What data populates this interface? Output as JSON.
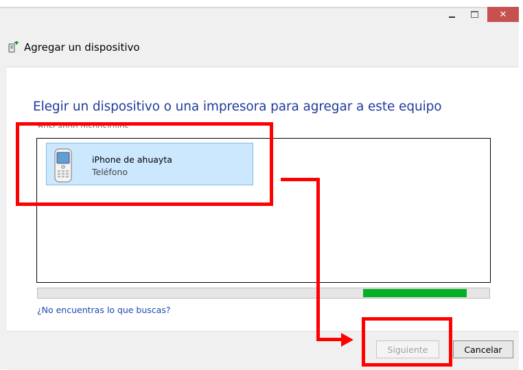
{
  "window": {
    "title": "Agregar un dispositivo",
    "minimize_symbol": "–",
    "maximize_symbol": "□",
    "close_symbol": "✕"
  },
  "main": {
    "heading": "Elegir un dispositivo o una impresora para agregar a este equipo",
    "status_text": "Buscando dispositivos",
    "devices": [
      {
        "name": "iPhone de ahuayta",
        "type": "Teléfono",
        "icon": "phone-icon"
      }
    ],
    "progress": {
      "start_fraction": 0.72,
      "end_fraction": 0.95,
      "color": "#06b025"
    },
    "help_link": "¿No encuentras lo que buscas?"
  },
  "footer": {
    "next_label": "Siguiente",
    "cancel_label": "Cancelar"
  },
  "colors": {
    "heading": "#1e3b9b",
    "link": "#1c49b2",
    "selection": "#cce8ff",
    "close_button": "#c75050",
    "annotation": "#ff0000"
  }
}
